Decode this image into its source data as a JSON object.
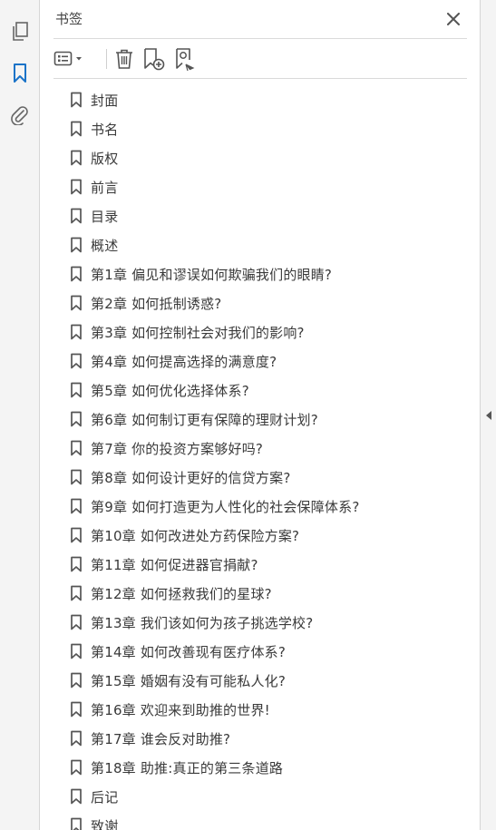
{
  "rail": {
    "pages_icon": "pages-icon",
    "bookmarks_icon": "bookmark-icon",
    "attachments_icon": "paperclip-icon"
  },
  "panel": {
    "title": "书签",
    "close_icon": "close-icon"
  },
  "toolbar": {
    "options_icon": "list-options-icon",
    "delete_icon": "trash-icon",
    "new_bookmark_icon": "new-bookmark-icon",
    "find_bookmark_icon": "find-bookmark-icon"
  },
  "colors": {
    "accent": "#1a73c8",
    "icon_gray": "#666666",
    "text": "#3a3a3a"
  },
  "bookmarks": [
    {
      "label": "封面"
    },
    {
      "label": "书名"
    },
    {
      "label": "版权"
    },
    {
      "label": "前言"
    },
    {
      "label": "目录"
    },
    {
      "label": "概述"
    },
    {
      "label": "第1章  偏见和谬误如何欺骗我们的眼睛?"
    },
    {
      "label": "第2章  如何抵制诱惑?"
    },
    {
      "label": "第3章  如何控制社会对我们的影响?"
    },
    {
      "label": "第4章  如何提高选择的满意度?"
    },
    {
      "label": "第5章  如何优化选择体系?"
    },
    {
      "label": "第6章  如何制订更有保障的理财计划?"
    },
    {
      "label": "第7章  你的投资方案够好吗?"
    },
    {
      "label": "第8章  如何设计更好的信贷方案?"
    },
    {
      "label": "第9章  如何打造更为人性化的社会保障体系?"
    },
    {
      "label": "第10章  如何改进处方药保险方案?"
    },
    {
      "label": "第11章  如何促进器官捐献?"
    },
    {
      "label": "第12章  如何拯救我们的星球?"
    },
    {
      "label": "第13章  我们该如何为孩子挑选学校?"
    },
    {
      "label": "第14章  如何改善现有医疗体系?"
    },
    {
      "label": "第15章  婚姻有没有可能私人化?"
    },
    {
      "label": "第16章  欢迎来到助推的世界!"
    },
    {
      "label": "第17章  谁会反对助推?"
    },
    {
      "label": "第18章  助推:真正的第三条道路"
    },
    {
      "label": "后记"
    },
    {
      "label": "致谢"
    }
  ]
}
